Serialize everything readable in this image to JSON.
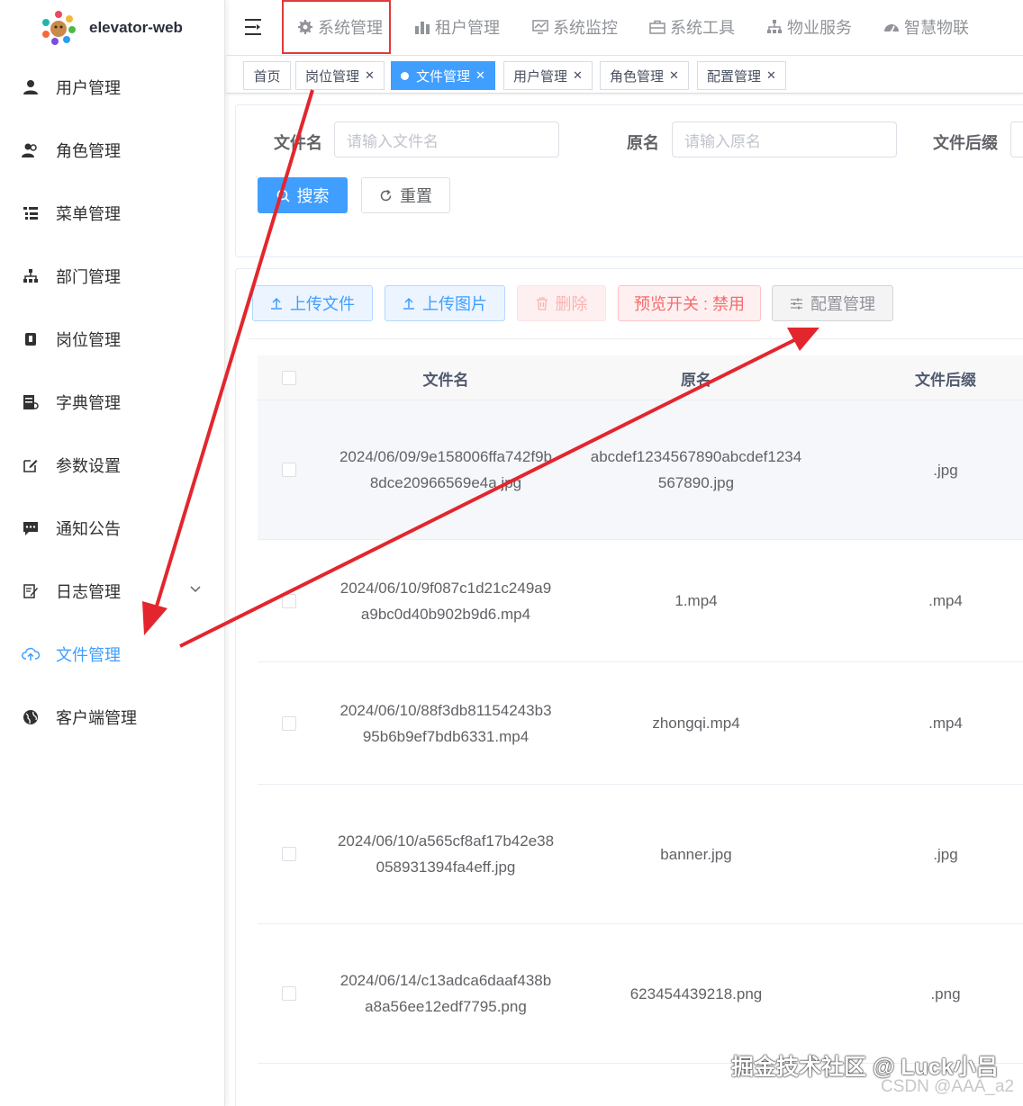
{
  "app": {
    "title": "elevator-web"
  },
  "sidebar": {
    "items": [
      {
        "label": "用户管理",
        "icon": "user-icon"
      },
      {
        "label": "角色管理",
        "icon": "peoples-icon"
      },
      {
        "label": "菜单管理",
        "icon": "tree-table-icon"
      },
      {
        "label": "部门管理",
        "icon": "tree-icon"
      },
      {
        "label": "岗位管理",
        "icon": "post-icon"
      },
      {
        "label": "字典管理",
        "icon": "dict-icon"
      },
      {
        "label": "参数设置",
        "icon": "edit-icon"
      },
      {
        "label": "通知公告",
        "icon": "message-icon"
      },
      {
        "label": "日志管理",
        "icon": "log-icon"
      },
      {
        "label": "文件管理",
        "icon": "upload-cloud-icon"
      },
      {
        "label": "客户端管理",
        "icon": "globe-icon"
      }
    ]
  },
  "topnav": {
    "items": [
      {
        "label": "系统管理"
      },
      {
        "label": "租户管理"
      },
      {
        "label": "系统监控"
      },
      {
        "label": "系统工具"
      },
      {
        "label": "物业服务"
      },
      {
        "label": "智慧物联"
      }
    ]
  },
  "tags": [
    {
      "label": "首页"
    },
    {
      "label": "岗位管理"
    },
    {
      "label": "文件管理"
    },
    {
      "label": "用户管理"
    },
    {
      "label": "角色管理"
    },
    {
      "label": "配置管理"
    }
  ],
  "search": {
    "filename_label": "文件名",
    "filename_placeholder": "请输入文件名",
    "original_label": "原名",
    "original_placeholder": "请输入原名",
    "suffix_label": "文件后缀",
    "search_btn": "搜索",
    "reset_btn": "重置"
  },
  "toolbar": {
    "upload_file": "上传文件",
    "upload_image": "上传图片",
    "delete": "删除",
    "preview_toggle": "预览开关 : 禁用",
    "config": "配置管理"
  },
  "table": {
    "columns": [
      "文件名",
      "原名",
      "文件后缀"
    ],
    "rows": [
      {
        "file_line1": "2024/06/09/9e158006ffa742f9b",
        "file_line2": "8dce20966569e4a.jpg",
        "orig_line1": "abcdef1234567890abcdef1234",
        "orig_line2": "567890.jpg",
        "suffix": ".jpg"
      },
      {
        "file_line1": "2024/06/10/9f087c1d21c249a9",
        "file_line2": "a9bc0d40b902b9d6.mp4",
        "orig_line1": "1.mp4",
        "orig_line2": "",
        "suffix": ".mp4"
      },
      {
        "file_line1": "2024/06/10/88f3db81154243b3",
        "file_line2": "95b6b9ef7bdb6331.mp4",
        "orig_line1": "zhongqi.mp4",
        "orig_line2": "",
        "suffix": ".mp4"
      },
      {
        "file_line1": "2024/06/10/a565cf8af17b42e38",
        "file_line2": "058931394fa4eff.jpg",
        "orig_line1": "banner.jpg",
        "orig_line2": "",
        "suffix": ".jpg"
      },
      {
        "file_line1": "2024/06/14/c13adca6daaf438b",
        "file_line2": "a8a56ee12edf7795.png",
        "orig_line1": "623454439218.png",
        "orig_line2": "",
        "suffix": ".png"
      }
    ]
  },
  "watermark": {
    "line1": "掘金技术社区 @ Luck小吕",
    "line2": "CSDN @AAA_a2"
  },
  "colors": {
    "primary": "#409eff",
    "annotation_red": "#e3262d",
    "danger": "#f56c6c"
  }
}
